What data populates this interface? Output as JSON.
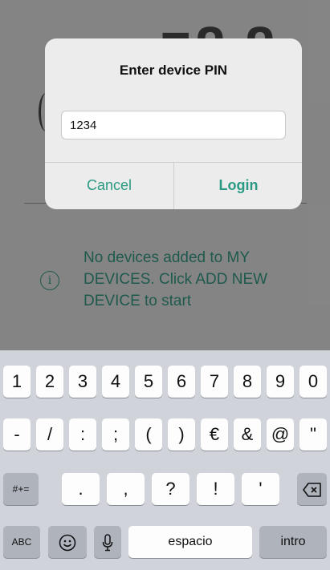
{
  "dialog": {
    "title": "Enter device PIN",
    "pin_value": "1234",
    "cancel_label": "Cancel",
    "login_label": "Login"
  },
  "background": {
    "empty_message": "No devices added to MY DEVICES. Click ADD NEW DEVICE to start",
    "info_icon": "info-icon"
  },
  "keyboard": {
    "row1": [
      "1",
      "2",
      "3",
      "4",
      "5",
      "6",
      "7",
      "8",
      "9",
      "0"
    ],
    "row2": [
      "-",
      "/",
      ":",
      ";",
      "(",
      ")",
      "€",
      "&",
      "@",
      "\""
    ],
    "row3": {
      "symbols_toggle": "#+=",
      "keys": [
        ".",
        ",",
        "?",
        "!",
        "'"
      ],
      "delete_icon": "backspace-icon"
    },
    "row4": {
      "abc_label": "ABC",
      "emoji_icon": "emoji-icon",
      "mic_icon": "microphone-icon",
      "space_label": "espacio",
      "return_label": "intro"
    }
  },
  "colors": {
    "accent": "#2b9a83",
    "accent_dim": "#2b7c6b"
  }
}
